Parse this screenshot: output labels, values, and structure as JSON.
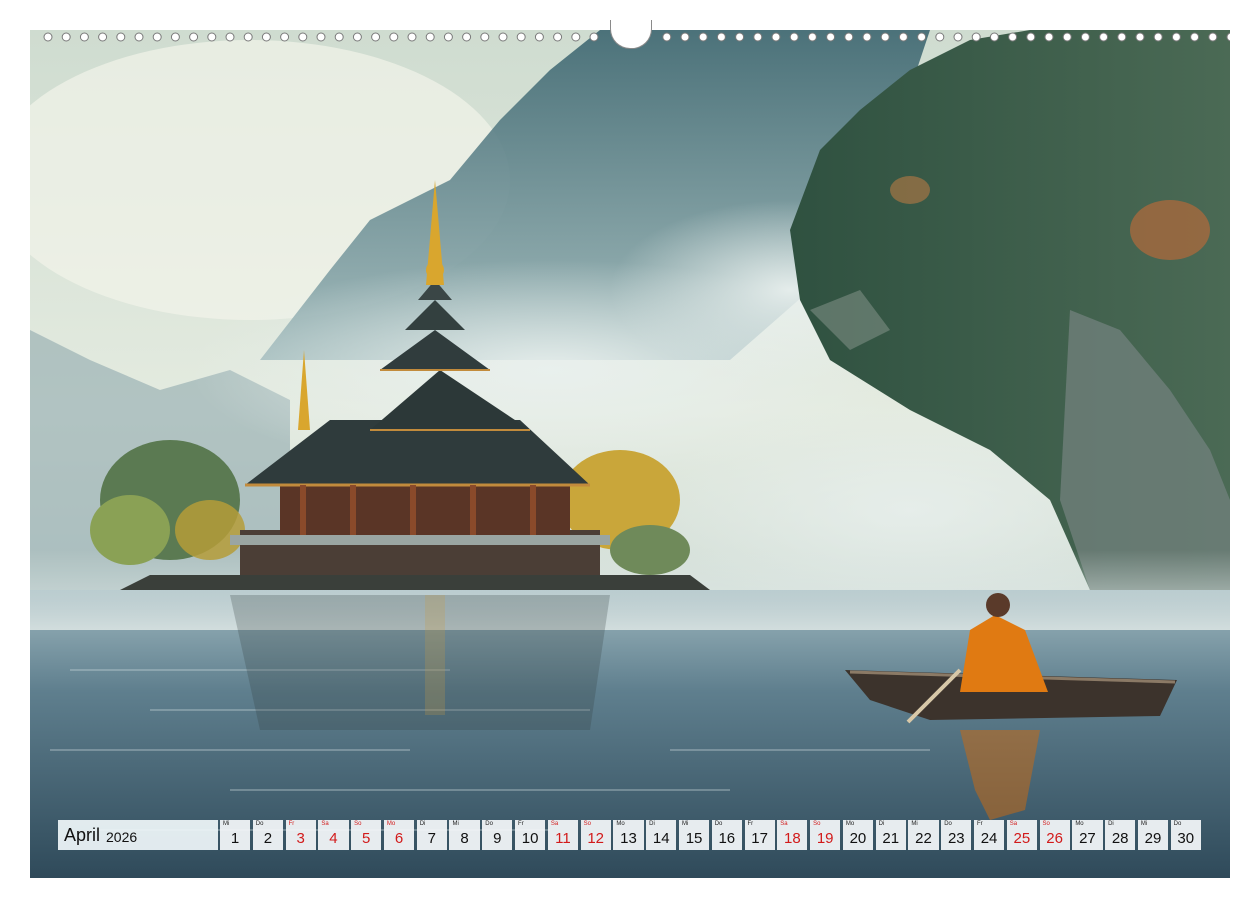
{
  "calendar": {
    "month": "April",
    "year": "2026",
    "days": [
      {
        "wd": "Mi",
        "d": "1",
        "weekend": false
      },
      {
        "wd": "Do",
        "d": "2",
        "weekend": false
      },
      {
        "wd": "Fr",
        "d": "3",
        "weekend": true
      },
      {
        "wd": "Sa",
        "d": "4",
        "weekend": true
      },
      {
        "wd": "So",
        "d": "5",
        "weekend": true
      },
      {
        "wd": "Mo",
        "d": "6",
        "weekend": true
      },
      {
        "wd": "Di",
        "d": "7",
        "weekend": false
      },
      {
        "wd": "Mi",
        "d": "8",
        "weekend": false
      },
      {
        "wd": "Do",
        "d": "9",
        "weekend": false
      },
      {
        "wd": "Fr",
        "d": "10",
        "weekend": false
      },
      {
        "wd": "Sa",
        "d": "11",
        "weekend": true
      },
      {
        "wd": "So",
        "d": "12",
        "weekend": true
      },
      {
        "wd": "Mo",
        "d": "13",
        "weekend": false
      },
      {
        "wd": "Di",
        "d": "14",
        "weekend": false
      },
      {
        "wd": "Mi",
        "d": "15",
        "weekend": false
      },
      {
        "wd": "Do",
        "d": "16",
        "weekend": false
      },
      {
        "wd": "Fr",
        "d": "17",
        "weekend": false
      },
      {
        "wd": "Sa",
        "d": "18",
        "weekend": true
      },
      {
        "wd": "So",
        "d": "19",
        "weekend": true
      },
      {
        "wd": "Mo",
        "d": "20",
        "weekend": false
      },
      {
        "wd": "Di",
        "d": "21",
        "weekend": false
      },
      {
        "wd": "Mi",
        "d": "22",
        "weekend": false
      },
      {
        "wd": "Do",
        "d": "23",
        "weekend": false
      },
      {
        "wd": "Fr",
        "d": "24",
        "weekend": false
      },
      {
        "wd": "Sa",
        "d": "25",
        "weekend": true
      },
      {
        "wd": "So",
        "d": "26",
        "weekend": true
      },
      {
        "wd": "Mo",
        "d": "27",
        "weekend": false
      },
      {
        "wd": "Di",
        "d": "28",
        "weekend": false
      },
      {
        "wd": "Mi",
        "d": "29",
        "weekend": false
      },
      {
        "wd": "Do",
        "d": "30",
        "weekend": false
      }
    ]
  },
  "colors": {
    "weekend": "#d21a1a",
    "robe": "#e07a12",
    "roof_gold": "#d9a62e"
  },
  "icons": {
    "binding": "spiral-binding-holes-icon",
    "hanger": "hanger-hook-icon"
  }
}
